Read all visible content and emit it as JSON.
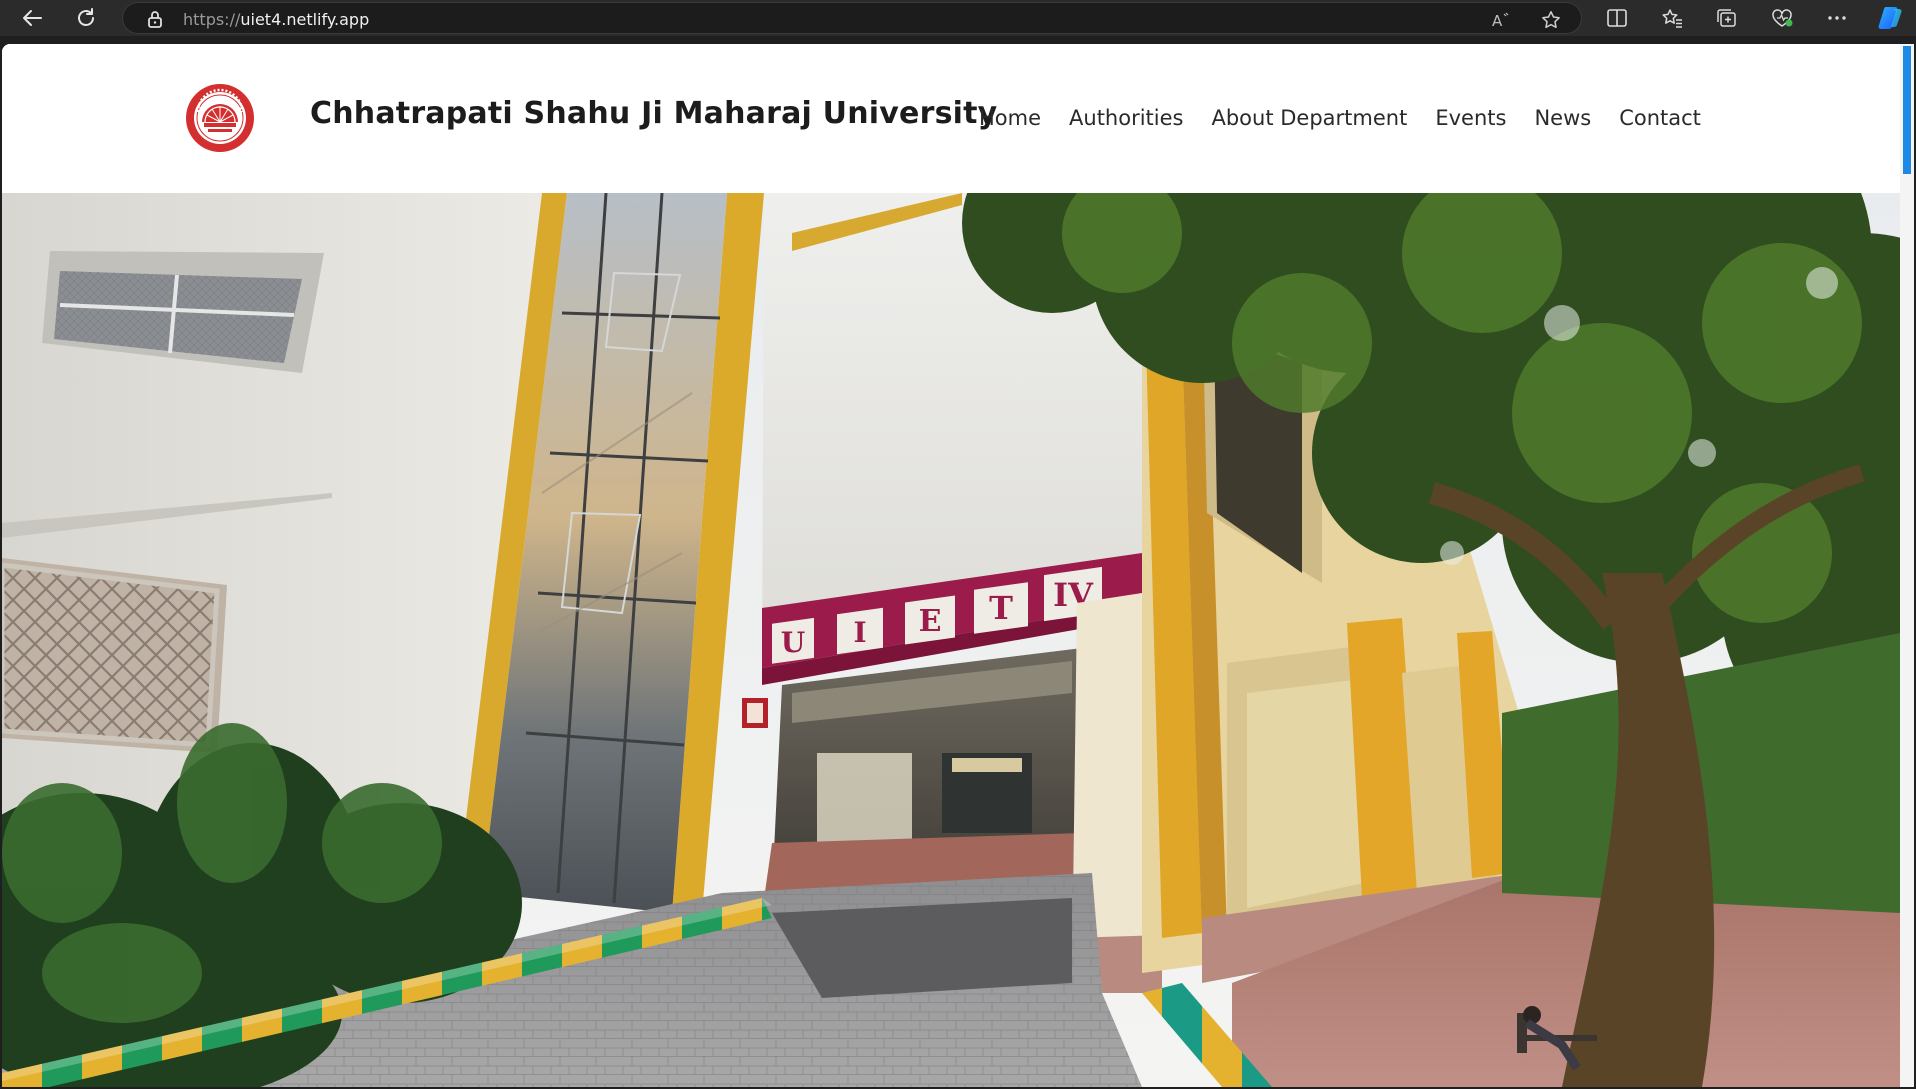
{
  "browser": {
    "url_scheme": "https://",
    "url_host": "uiet4.netlify.app",
    "icons": [
      "back-icon",
      "refresh-icon",
      "lock-icon",
      "read-aloud-icon",
      "favorite-star-icon",
      "split-screen-icon",
      "favorites-icon",
      "collections-icon",
      "browser-essentials-icon",
      "more-icon",
      "copilot-icon"
    ]
  },
  "site": {
    "title": "Chhatrapati Shahu Ji Maharaj University",
    "nav": [
      "Home",
      "Authorities",
      "About Department",
      "Events",
      "News",
      "Contact"
    ]
  },
  "hero": {
    "sign_letters": [
      "U",
      "I",
      "E",
      "T",
      "IV"
    ]
  },
  "colors": {
    "accent_scroll": "#1e88e5",
    "logo_red": "#d32f2f",
    "sign_maroon": "#9b1b4a",
    "pillar_yellow": "#e4b22f"
  }
}
